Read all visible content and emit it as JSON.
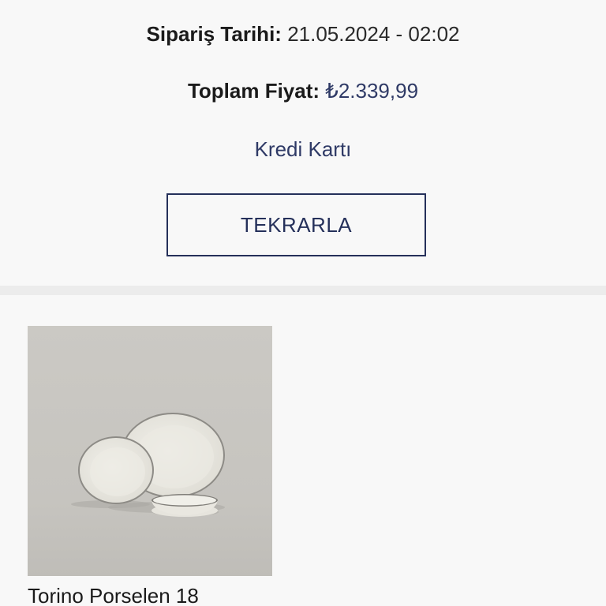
{
  "order": {
    "date_label": "Sipariş Tarihi:",
    "date_value": "21.05.2024 - 02:02",
    "total_label": "Toplam Fiyat:",
    "total_value": "₺2.339,99",
    "payment_method": "Kredi Kartı",
    "repeat_button": "TEKRARLA"
  },
  "products": [
    {
      "name": "Torino Porselen 18",
      "image_icon": "porcelain-plates-image"
    }
  ],
  "colors": {
    "accent": "#25305a",
    "price": "#2f3a66",
    "background": "#f8f8f8",
    "divider": "#ececec"
  }
}
